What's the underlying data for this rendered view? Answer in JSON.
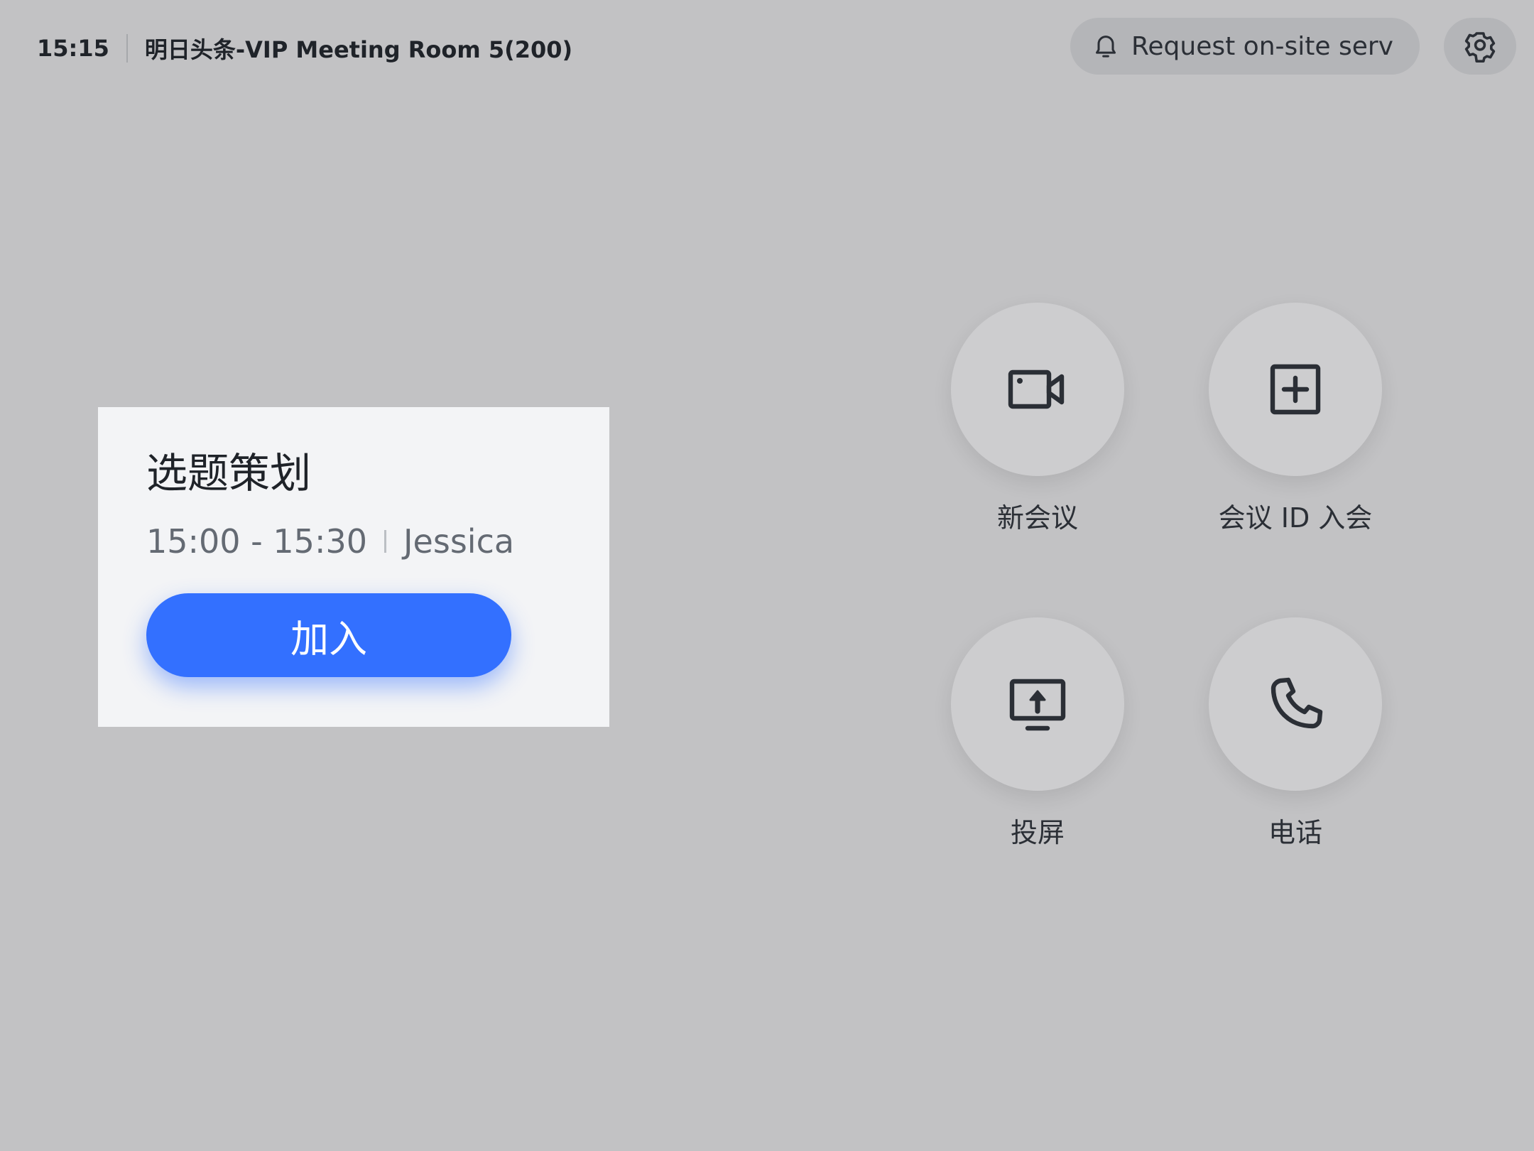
{
  "status_bar": {
    "time": "15:15",
    "room_name": "明日头条-VIP Meeting Room 5(200)"
  },
  "header": {
    "service_button_label": "Request on-site serv",
    "service_icon": "bell-icon",
    "settings_icon": "gear-icon"
  },
  "meeting": {
    "title": "选题策划",
    "time_range": "15:00 - 15:30",
    "organizer": "Jessica",
    "join_label": "加入"
  },
  "actions": [
    {
      "label": "新会议",
      "icon": "video-camera-icon"
    },
    {
      "label": "会议 ID 入会",
      "icon": "plus-square-icon"
    },
    {
      "label": "投屏",
      "icon": "screen-share-icon"
    },
    {
      "label": "电话",
      "icon": "phone-icon"
    }
  ],
  "colors": {
    "background": "#c2c2c4",
    "card": "#f3f4f6",
    "accent": "#3370ff",
    "text": "#1f2329",
    "muted_text": "#646a73"
  }
}
